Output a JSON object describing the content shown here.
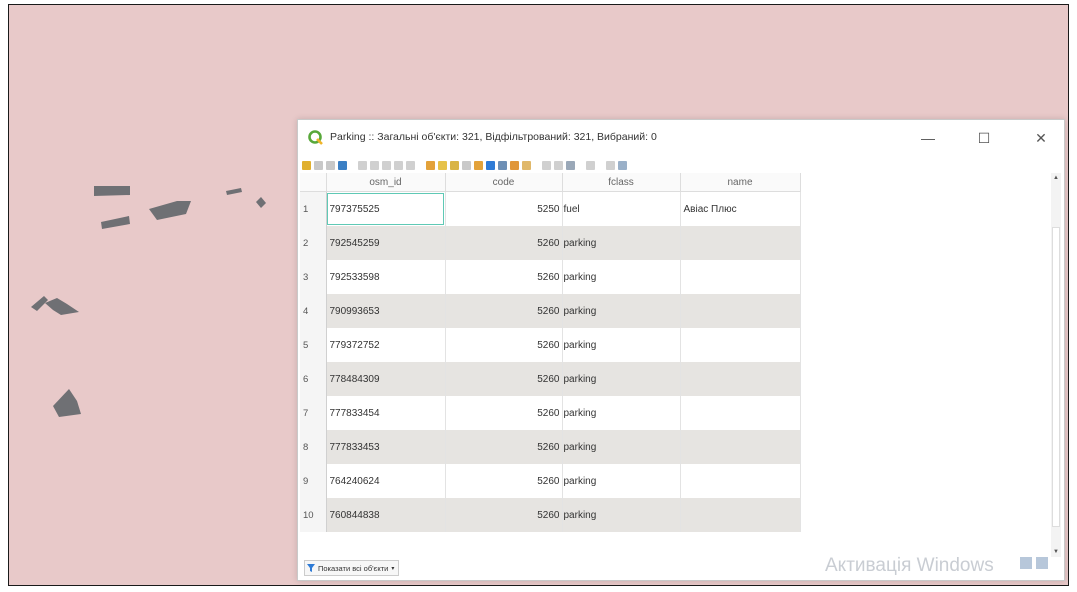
{
  "window": {
    "title": "Parking :: Загальні об'єкти: 321, Відфільтрований: 321, Вибраний: 0",
    "minimize_glyph": "—",
    "maximize_glyph": "☐",
    "close_glyph": "✕"
  },
  "table": {
    "columns": [
      "osm_id",
      "code",
      "fclass",
      "name"
    ],
    "rows": [
      {
        "n": "1",
        "osm_id": "797375525",
        "code": "5250",
        "fclass": "fuel",
        "name": "Авіас Плюс"
      },
      {
        "n": "2",
        "osm_id": "792545259",
        "code": "5260",
        "fclass": "parking",
        "name": ""
      },
      {
        "n": "3",
        "osm_id": "792533598",
        "code": "5260",
        "fclass": "parking",
        "name": ""
      },
      {
        "n": "4",
        "osm_id": "790993653",
        "code": "5260",
        "fclass": "parking",
        "name": ""
      },
      {
        "n": "5",
        "osm_id": "779372752",
        "code": "5260",
        "fclass": "parking",
        "name": ""
      },
      {
        "n": "6",
        "osm_id": "778484309",
        "code": "5260",
        "fclass": "parking",
        "name": ""
      },
      {
        "n": "7",
        "osm_id": "777833454",
        "code": "5260",
        "fclass": "parking",
        "name": ""
      },
      {
        "n": "8",
        "osm_id": "777833453",
        "code": "5260",
        "fclass": "parking",
        "name": ""
      },
      {
        "n": "9",
        "osm_id": "764240624",
        "code": "5260",
        "fclass": "parking",
        "name": ""
      },
      {
        "n": "10",
        "osm_id": "760844838",
        "code": "5260",
        "fclass": "parking",
        "name": ""
      }
    ]
  },
  "footer": {
    "filter_label": "Показати всі об'єкти"
  },
  "watermark": "Активація Windows",
  "colors": {
    "map_background": "#e8c9c9",
    "polygon_fill": "#6f7074",
    "selected_cell_border": "#5fc9b5",
    "stripe_row": "#e6e4e1"
  }
}
